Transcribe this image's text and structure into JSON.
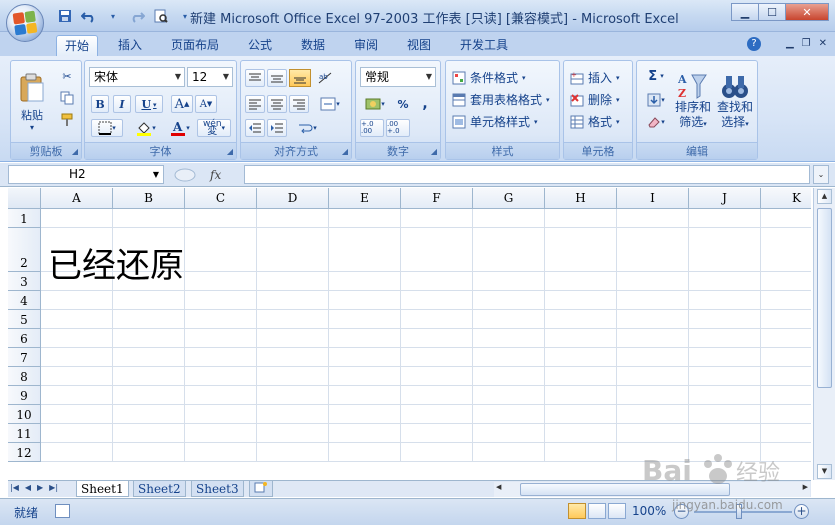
{
  "window": {
    "title": "新建 Microsoft Office Excel 97-2003 工作表  [只读]  [兼容模式] - Microsoft Excel",
    "minimize": "▁",
    "maximize": "☐",
    "close": "✕"
  },
  "quick_access": [
    "save-icon",
    "undo-icon",
    "redo-icon",
    "print-preview-icon"
  ],
  "ribbon_tabs": [
    "开始",
    "插入",
    "页面布局",
    "公式",
    "数据",
    "审阅",
    "视图",
    "开发工具"
  ],
  "ribbon": {
    "clipboard": {
      "label": "剪贴板",
      "paste": "粘贴"
    },
    "font": {
      "label": "字体",
      "name": "宋体",
      "size": "12",
      "bold": "B",
      "italic": "I",
      "underline": "U",
      "grow": "A",
      "shrink": "A",
      "phonetic": "wén"
    },
    "alignment": {
      "label": "对齐方式"
    },
    "number": {
      "label": "数字",
      "format": "常规",
      "percent": "%",
      "comma": ",",
      "inc_dec": "+.0 .00",
      "dec_dec": ".00 +.0"
    },
    "styles": {
      "label": "样式",
      "conditional": "条件格式",
      "table": "套用表格格式",
      "cell": "单元格样式"
    },
    "cells": {
      "label": "单元格",
      "insert": "插入",
      "delete": "删除",
      "format": "格式"
    },
    "editing": {
      "label": "编辑",
      "sum": "Σ",
      "sort": "排序和",
      "sort2": "筛选",
      "find": "查找和",
      "find2": "选择"
    }
  },
  "formula_bar": {
    "name_box": "H2",
    "fx": "fx",
    "value": ""
  },
  "columns": [
    "A",
    "B",
    "C",
    "D",
    "E",
    "F",
    "G",
    "H",
    "I",
    "J",
    "K"
  ],
  "rows": [
    "1",
    "2",
    "3",
    "4",
    "5",
    "6",
    "7",
    "8",
    "9",
    "10",
    "11",
    "12"
  ],
  "cell_A2": "已经还原",
  "sheets": [
    "Sheet1",
    "Sheet2",
    "Sheet3"
  ],
  "status": {
    "ready": "就绪",
    "zoom": "100%",
    "minus": "−",
    "plus": "+"
  },
  "watermark": {
    "brand": "Baidu 经验",
    "url": "jingyan.baidu.com"
  }
}
